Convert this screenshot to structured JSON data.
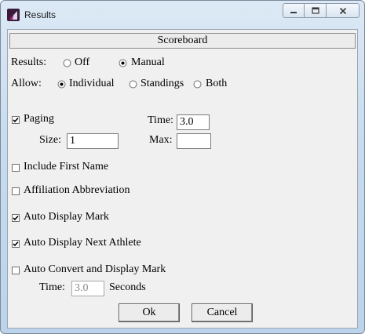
{
  "window": {
    "title": "Results"
  },
  "header": {
    "title": "Scoreboard"
  },
  "results": {
    "label": "Results:",
    "options": [
      "Off",
      "Manual"
    ],
    "selected": "Manual"
  },
  "allow": {
    "label": "Allow:",
    "options": [
      "Individual",
      "Standings",
      "Both"
    ],
    "selected": "Individual"
  },
  "paging": {
    "label": "Paging",
    "checked": true,
    "time_label": "Time:",
    "time_value": "3.0",
    "size_label": "Size:",
    "size_value": "1",
    "max_label": "Max:",
    "max_value": ""
  },
  "options": [
    {
      "label": "Include First Name",
      "checked": false
    },
    {
      "label": "Affiliation Abbreviation",
      "checked": false
    },
    {
      "label": "Auto Display Mark",
      "checked": true
    },
    {
      "label": "Auto Display Next Athlete",
      "checked": true
    },
    {
      "label": "Auto Convert and Display Mark",
      "checked": false
    }
  ],
  "convert": {
    "time_label": "Time:",
    "time_value": "3.0",
    "unit": "Seconds"
  },
  "buttons": {
    "ok": "Ok",
    "cancel": "Cancel"
  },
  "colors": {
    "frame": "#c9dcee",
    "client": "#f0f0f0"
  }
}
